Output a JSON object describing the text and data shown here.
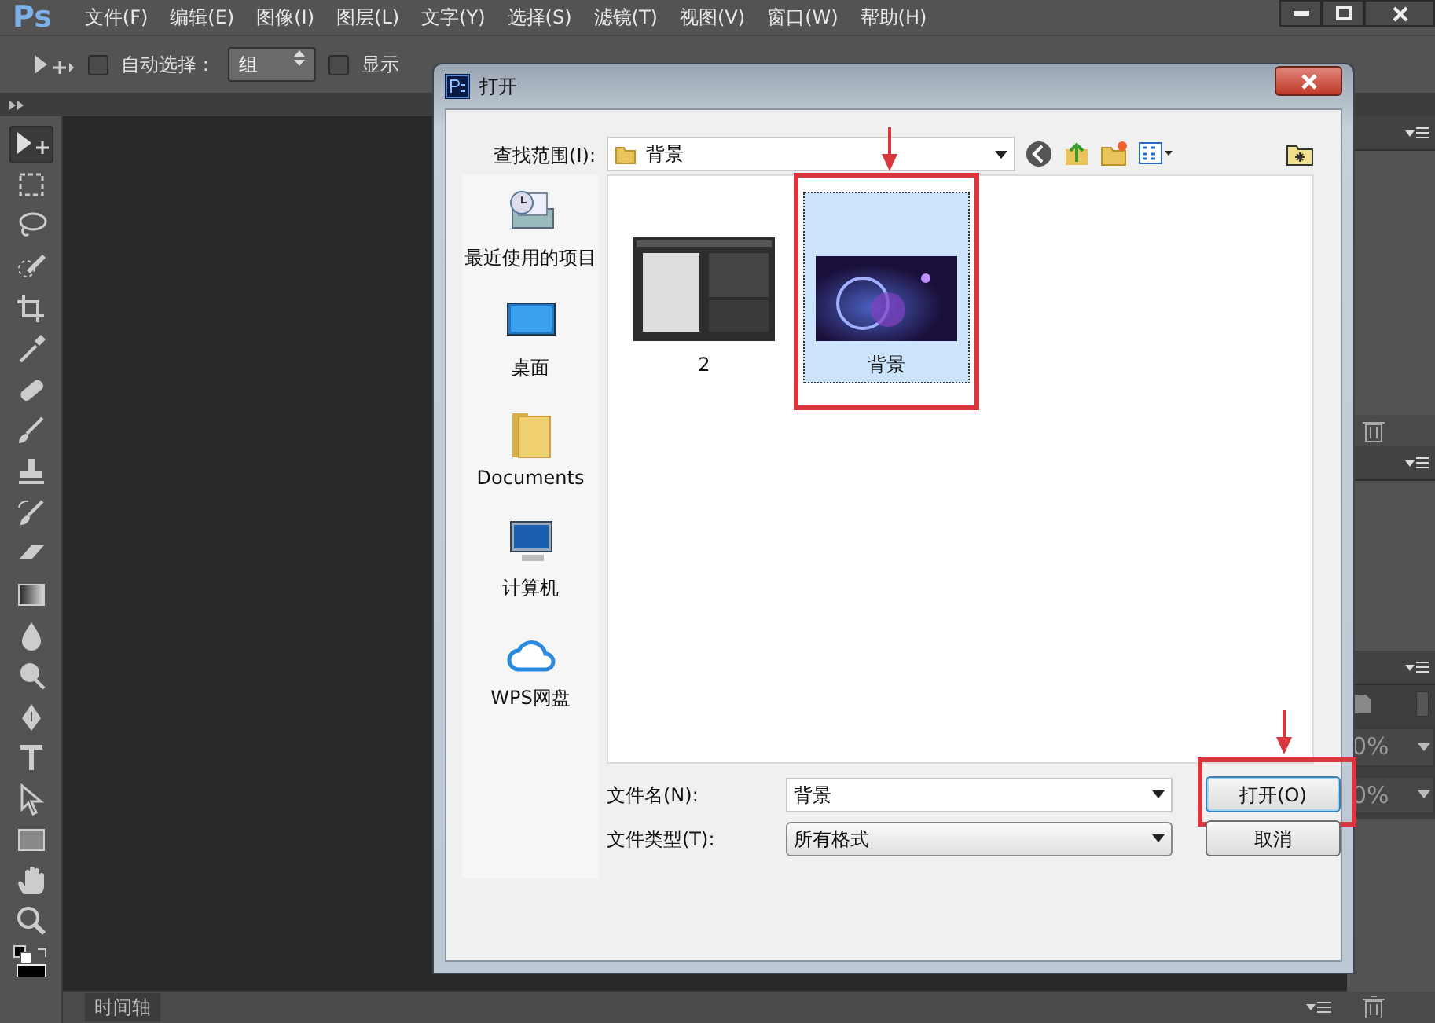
{
  "app": {
    "logo": "Ps",
    "menu": [
      "文件(F)",
      "编辑(E)",
      "图像(I)",
      "图层(L)",
      "文字(Y)",
      "选择(S)",
      "滤镜(T)",
      "视图(V)",
      "窗口(W)",
      "帮助(H)"
    ]
  },
  "options_bar": {
    "auto_select": {
      "label": "自动选择：",
      "checked": false
    },
    "auto_select_target": "组",
    "show_transform": {
      "label": "显示",
      "checked": false
    }
  },
  "tools": [
    {
      "kind": "move",
      "selected": true
    },
    {
      "kind": "marquee",
      "selected": false
    },
    {
      "kind": "lasso",
      "selected": false
    },
    {
      "kind": "quick-select",
      "selected": false
    },
    {
      "kind": "crop",
      "selected": false
    },
    {
      "kind": "eyedropper",
      "selected": false
    },
    {
      "kind": "heal",
      "selected": false
    },
    {
      "kind": "brush",
      "selected": false
    },
    {
      "kind": "stamp",
      "selected": false
    },
    {
      "kind": "history-brush",
      "selected": false
    },
    {
      "kind": "eraser",
      "selected": false
    },
    {
      "kind": "gradient",
      "selected": false
    },
    {
      "kind": "blur",
      "selected": false
    },
    {
      "kind": "dodge",
      "selected": false
    },
    {
      "kind": "pen",
      "selected": false
    },
    {
      "kind": "type",
      "selected": false
    },
    {
      "kind": "path-select",
      "selected": false
    },
    {
      "kind": "shape",
      "selected": false
    },
    {
      "kind": "hand",
      "selected": false
    },
    {
      "kind": "zoom",
      "selected": false
    }
  ],
  "right_panels": {
    "fields": [
      "0%",
      "0%"
    ]
  },
  "timeline": {
    "tab": "时间轴"
  },
  "dialog": {
    "title": "打开",
    "look_in": {
      "label": "查找范围(I):",
      "value": "背景"
    },
    "places": [
      {
        "label": "最近使用的项目",
        "kind": "recent"
      },
      {
        "label": "桌面",
        "kind": "desktop"
      },
      {
        "label": "Documents",
        "kind": "folder"
      },
      {
        "label": "计算机",
        "kind": "computer"
      },
      {
        "label": "WPS网盘",
        "kind": "cloud"
      }
    ],
    "files": [
      {
        "name": "2",
        "kind": "screenshot",
        "selected": false,
        "highlighted": false
      },
      {
        "name": "背景",
        "kind": "image",
        "selected": true,
        "highlighted": true
      }
    ],
    "file_name": {
      "label": "文件名(N):",
      "value": "背景"
    },
    "file_type": {
      "label": "文件类型(T):",
      "value": "所有格式"
    },
    "buttons": [
      {
        "label": "打开(O)",
        "kind": "default",
        "highlighted": true
      },
      {
        "label": "取消",
        "kind": "cancel",
        "highlighted": false
      }
    ]
  }
}
